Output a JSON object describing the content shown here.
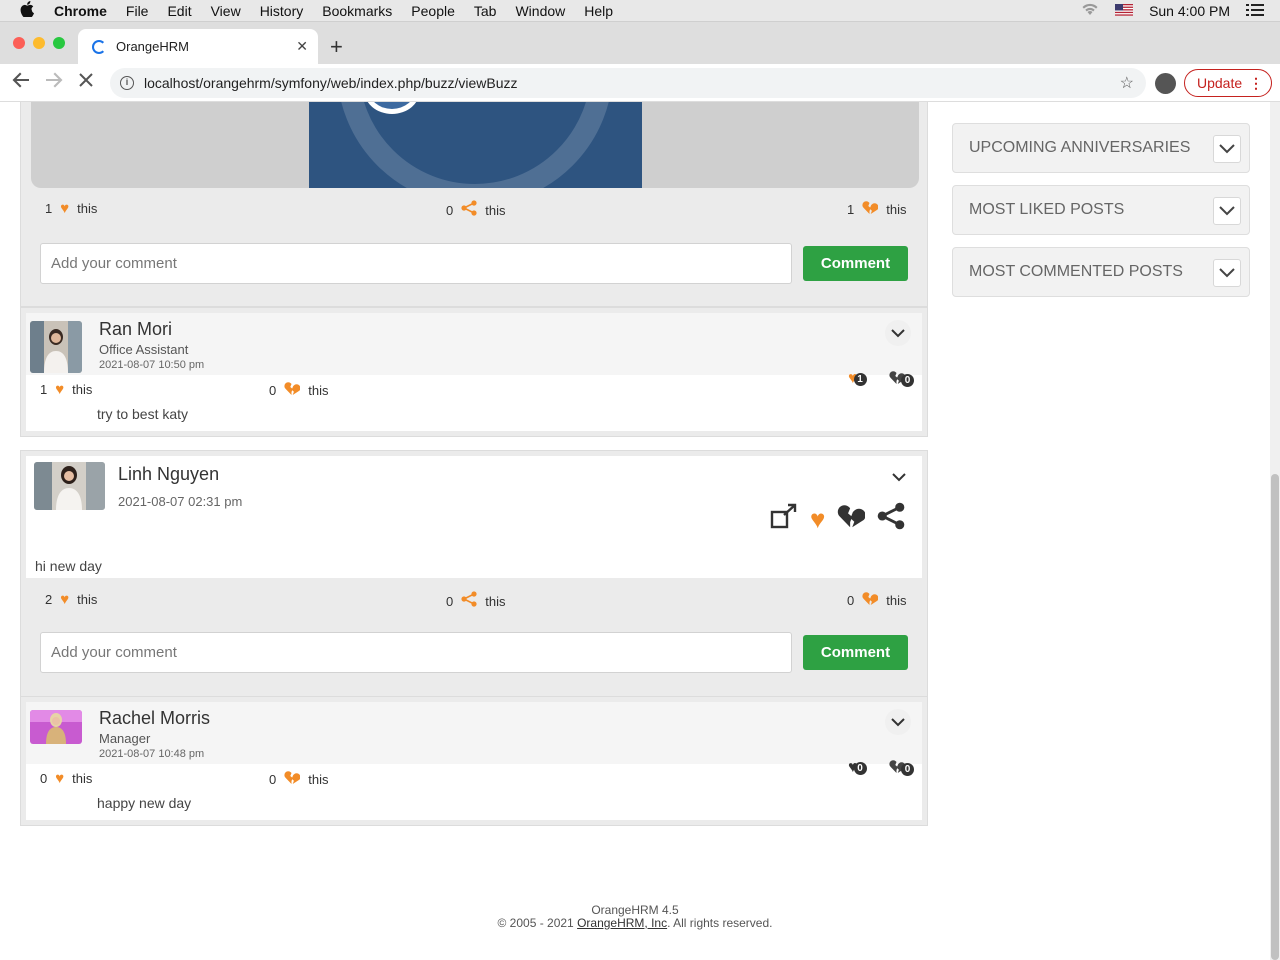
{
  "menubar": {
    "app": "Chrome",
    "items": [
      "File",
      "Edit",
      "View",
      "History",
      "Bookmarks",
      "People",
      "Tab",
      "Window",
      "Help"
    ],
    "clock": "Sun 4:00 PM"
  },
  "browser": {
    "tab_title": "OrangeHRM",
    "url": "localhost/orangehrm/symfony/web/index.php/buzz/viewBuzz",
    "update_label": "Update"
  },
  "post_top": {
    "likes": "1",
    "shares": "0",
    "dislikes": "1",
    "this": "this",
    "comment_placeholder": "Add your comment",
    "comment_label": "Comment"
  },
  "share_ran": {
    "name": "Ran Mori",
    "job": "Office Assistant",
    "date": "2021-08-07 10:50 pm",
    "likes": "1",
    "dislikes": "0",
    "this": "this",
    "text": "try to best katy",
    "like_badge": "1",
    "dislike_badge": "0"
  },
  "post_linh": {
    "name": "Linh Nguyen",
    "date": "2021-08-07 02:31 pm",
    "text": "hi new day",
    "likes": "2",
    "shares": "0",
    "dislikes": "0",
    "this": "this",
    "comment_placeholder": "Add your comment",
    "comment_label": "Comment"
  },
  "share_rachel": {
    "name": "Rachel Morris",
    "job": "Manager",
    "date": "2021-08-07 10:48 pm",
    "likes": "0",
    "dislikes": "0",
    "this": "this",
    "text": "happy new day",
    "like_badge": "0",
    "dislike_badge": "0"
  },
  "sidebar": {
    "widgets": [
      "UPCOMING ANNIVERSARIES",
      "MOST LIKED POSTS",
      "MOST COMMENTED POSTS"
    ]
  },
  "footer": {
    "version": "OrangeHRM 4.5",
    "copyright": "© 2005 - 2021",
    "company": "OrangeHRM, Inc",
    "rights": ". All rights reserved."
  },
  "colors": {
    "accent_orange": "#f28c28",
    "comment_green": "#2ea143",
    "update_red": "#c5221f"
  },
  "icons": [
    "apple-icon",
    "wifi-icon",
    "flag-icon",
    "list-icon",
    "spinner-icon",
    "close-icon",
    "plus-icon",
    "back-icon",
    "forward-icon",
    "stop-icon",
    "info-icon",
    "star-icon",
    "profile-icon",
    "heart-icon",
    "share-icon",
    "broken-heart-icon",
    "chevron-down-icon",
    "external-share-icon"
  ]
}
